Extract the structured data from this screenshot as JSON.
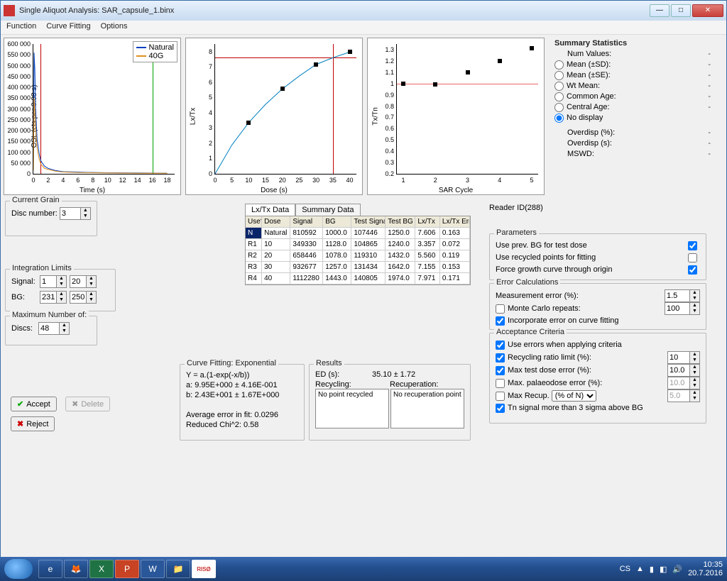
{
  "window_title": "Single Aliquot Analysis: SAR_capsule_1.binx",
  "menu": {
    "function": "Function",
    "curve_fitting": "Curve Fitting",
    "options": "Options"
  },
  "chart_data": [
    {
      "type": "line",
      "title": "",
      "xlabel": "Time (s)",
      "ylabel": "OSL (cts per 0.08 s)",
      "xlim": [
        0,
        19
      ],
      "ylim": [
        0,
        600000
      ],
      "x_ticks": [
        0,
        2,
        4,
        6,
        8,
        10,
        12,
        14,
        16,
        18
      ],
      "y_ticks": [
        0,
        50000,
        100000,
        150000,
        200000,
        250000,
        300000,
        350000,
        400000,
        450000,
        500000,
        550000,
        600000
      ],
      "y_tick_labels": [
        "0",
        "50 000",
        "100 000",
        "150 000",
        "200 000",
        "250 000",
        "300 000",
        "350 000",
        "400 000",
        "450 000",
        "500 000",
        "550 000",
        "600 000"
      ],
      "series": [
        {
          "name": "Natural",
          "color": "#0040c0",
          "x": [
            0,
            0.1,
            0.2,
            0.3,
            0.5,
            0.8,
            1,
            1.5,
            2,
            3,
            4,
            6,
            8,
            10,
            14,
            18
          ],
          "y": [
            20000,
            560000,
            480000,
            300000,
            160000,
            90000,
            60000,
            35000,
            25000,
            15000,
            10000,
            8000,
            6000,
            5000,
            4000,
            3000
          ]
        },
        {
          "name": "40G",
          "color": "#e09020",
          "x": [
            0,
            0.1,
            0.2,
            0.3,
            0.5,
            0.8,
            1,
            1.5,
            2,
            3,
            4,
            6,
            8,
            10,
            14,
            18
          ],
          "y": [
            15000,
            350000,
            300000,
            210000,
            120000,
            65000,
            45000,
            25000,
            20000,
            12000,
            8000,
            6000,
            5000,
            4000,
            3000,
            2500
          ]
        }
      ],
      "markers": [
        {
          "type": "vline",
          "x": 1,
          "color": "#c00000"
        },
        {
          "type": "vline",
          "x": 16,
          "color": "#00a000"
        }
      ]
    },
    {
      "type": "line",
      "title": "",
      "xlabel": "Dose (s)",
      "ylabel": "Lx/Tx",
      "xlim": [
        0,
        42
      ],
      "ylim": [
        0,
        8.5
      ],
      "x_ticks": [
        0,
        5,
        10,
        15,
        20,
        25,
        30,
        35,
        40
      ],
      "y_ticks": [
        0,
        1,
        2,
        3,
        4,
        5,
        6,
        7,
        8
      ],
      "series": [
        {
          "name": "fit",
          "color": "#0080c0",
          "x": [
            0,
            5,
            10,
            15,
            20,
            25,
            30,
            35,
            40
          ],
          "y": [
            0,
            1.89,
            3.36,
            4.55,
            5.56,
            6.4,
            7.16,
            7.6,
            7.97
          ]
        }
      ],
      "points": [
        {
          "x": 10,
          "y": 3.357
        },
        {
          "x": 20,
          "y": 5.56
        },
        {
          "x": 30,
          "y": 7.155
        },
        {
          "x": 40,
          "y": 7.971
        }
      ],
      "markers": [
        {
          "type": "hline",
          "y": 7.606,
          "color": "#c00000"
        },
        {
          "type": "vline",
          "x": 35.1,
          "color": "#c00000"
        }
      ]
    },
    {
      "type": "scatter",
      "title": "",
      "xlabel": "SAR Cycle",
      "ylabel": "Tx/Tn",
      "xlim": [
        0.8,
        5.2
      ],
      "ylim": [
        0.2,
        1.35
      ],
      "x_ticks": [
        1,
        2,
        3,
        4,
        5
      ],
      "y_ticks": [
        0.2,
        0.3,
        0.4,
        0.5,
        0.6,
        0.7,
        0.8,
        0.9,
        1.0,
        1.1,
        1.2,
        1.3
      ],
      "points": [
        {
          "x": 1,
          "y": 1.0
        },
        {
          "x": 2,
          "y": 0.99
        },
        {
          "x": 3,
          "y": 1.1
        },
        {
          "x": 4,
          "y": 1.2
        },
        {
          "x": 5,
          "y": 1.31
        }
      ],
      "markers": [
        {
          "type": "hline",
          "y": 1.0,
          "color": "#e66"
        }
      ]
    }
  ],
  "legend": {
    "natural": "Natural",
    "g40": "40G"
  },
  "stats": {
    "header": "Summary Statistics",
    "num_values_lbl": "Num Values:",
    "mean_sd": "Mean (±SD):",
    "mean_se": "Mean (±SE):",
    "wt_mean": "Wt Mean:",
    "common_age": "Common Age:",
    "central_age": "Central Age:",
    "no_display": "No display",
    "overdisp_pct": "Overdisp (%):",
    "overdisp_s": "Overdisp (s):",
    "mswd": "MSWD:",
    "dash": "-"
  },
  "current_grain": {
    "label": "Current Grain",
    "disc_number_lbl": "Disc number:",
    "disc_number": "3"
  },
  "integration": {
    "label": "Integration Limits",
    "signal_lbl": "Signal:",
    "signal_a": "1",
    "signal_b": "20",
    "bg_lbl": "BG:",
    "bg_a": "231",
    "bg_b": "250"
  },
  "maxdiscs": {
    "label": "Maximum Number of:",
    "discs_lbl": "Discs:",
    "discs": "48"
  },
  "tabs": {
    "lxtx": "Lx/Tx Data",
    "summary": "Summary Data"
  },
  "table": {
    "headers": [
      "Use?",
      "Dose",
      "Signal",
      "BG",
      "Test Signal",
      "Test BG",
      "Lx/Tx",
      "Lx/Tx Err"
    ],
    "rows": [
      [
        "N",
        "Natural",
        "810592",
        "1000.0",
        "107446",
        "1250.0",
        "7.606",
        "0.163"
      ],
      [
        "R1",
        "10",
        "349330",
        "1128.0",
        "104865",
        "1240.0",
        "3.357",
        "0.072"
      ],
      [
        "R2",
        "20",
        "658446",
        "1078.0",
        "119310",
        "1432.0",
        "5.560",
        "0.119"
      ],
      [
        "R3",
        "30",
        "932677",
        "1257.0",
        "131434",
        "1642.0",
        "7.155",
        "0.153"
      ],
      [
        "R4",
        "40",
        "1112280",
        "1443.0",
        "140805",
        "1974.0",
        "7.971",
        "0.171"
      ]
    ]
  },
  "reader_id": "Reader ID(288)",
  "parameters": {
    "label": "Parameters",
    "use_prev_bg": "Use prev. BG for test dose",
    "use_recycled": "Use recycled points for fitting",
    "force_origin": "Force growth curve through origin"
  },
  "errcalc": {
    "label": "Error Calculations",
    "meas_err": "Measurement error (%):",
    "meas_err_v": "1.5",
    "monte": "Monte Carlo repeats:",
    "monte_v": "100",
    "incorp": "Incorporate error on curve fitting"
  },
  "accept": {
    "label": "Acceptance Criteria",
    "use_errors": "Use errors when applying criteria",
    "recycling": "Recycling ratio limit (%):",
    "recycling_v": "10",
    "max_test": "Max test dose error (%):",
    "max_test_v": "10.0",
    "max_paleo": "Max. palaeodose error (%):",
    "max_paleo_v": "10.0",
    "max_recup": "Max Recup.",
    "max_recup_sel": "(% of N)",
    "max_recup_v": "5.0",
    "tn_signal": "Tn signal more than 3 sigma above BG"
  },
  "cf": {
    "label": "Curve Fitting: Exponential",
    "eq": "Y = a.(1-exp(-x/b))",
    "a": "a: 9.95E+000 ± 4.16E-001",
    "b": "b: 2.43E+001 ± 1.67E+000",
    "avg_err": "Average error in fit: 0.0296",
    "chi2": "Reduced Chi^2: 0.58"
  },
  "results": {
    "label": "Results",
    "ed_lbl": "ED (s):",
    "ed_val": "35.10  ±  1.72",
    "recycling_lbl": "Recycling:",
    "recycling_body": "No point recycled",
    "recup_lbl": "Recuperation:",
    "recup_body": "No recuperation point"
  },
  "buttons": {
    "accept": "Accept",
    "delete": "Delete",
    "reject": "Reject"
  },
  "taskbar": {
    "lang": "CS",
    "time": "10:35",
    "date": "20.7.2016"
  }
}
